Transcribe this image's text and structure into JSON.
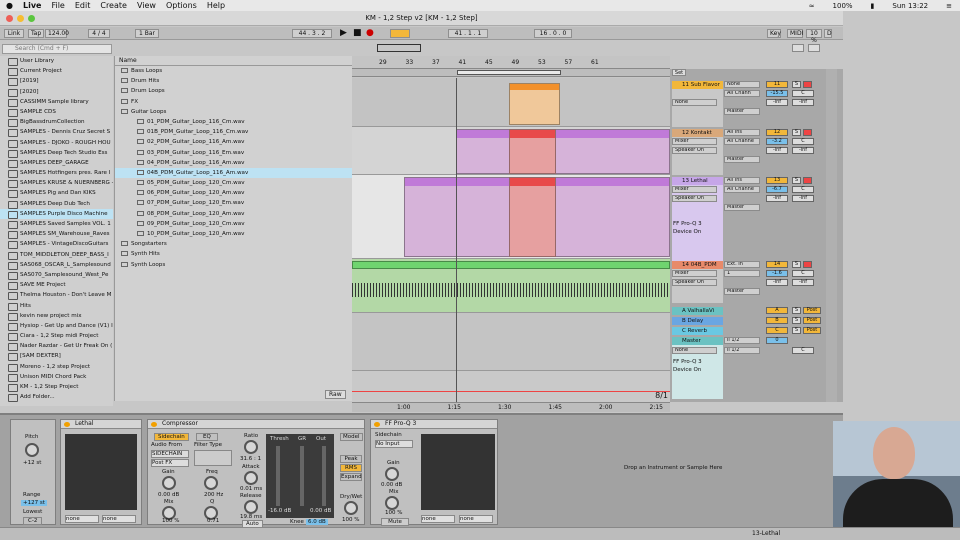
{
  "menubar": {
    "app": "Live",
    "items": [
      "File",
      "Edit",
      "Create",
      "View",
      "Options",
      "Help"
    ],
    "battery": "100%",
    "clock": "Sun 13:22"
  },
  "window": {
    "title": "KM - 1,2 Step v2  [KM - 1,2 Step]"
  },
  "transport": {
    "link": "Link",
    "tap": "Tap",
    "tempo": "124.00",
    "sig": "4 / 4",
    "quant": "1 Bar",
    "pos1": "44 .  3 .  2",
    "pos2": "41 .  1 .  1",
    "len": "16 .  0 .  0",
    "key": "Key",
    "midi": "MIDI",
    "cpu": "10 %",
    "d": "D"
  },
  "search": {
    "placeholder": "Search (Cmd + F)"
  },
  "places": [
    "User Library",
    "Current Project",
    "[2019]",
    "[2020]",
    "CASSIMM Sample library",
    "SAMPLE CDS",
    "BigBassdrumCollection",
    "SAMPLES - Dennis Cruz Secret S",
    "SAMPLES - DJOKO - ROUGH HOU",
    "SAMPLES Deep Tech Studio Ess",
    "SAMPLES DEEP_GARAGE",
    "SAMPLES Hotfingers pres. Rare I",
    "SAMPLES KRUSE & NUERNBERG -",
    "SAMPLES Pig and Dan KIKS",
    "SAMPLES Deep Dub Tech",
    "SAMPLES Purple Disco Machine",
    "SAMPLES Saved Samples VOL. 1",
    "SAMPLES SM_Warehouse_Raves",
    "SAMPLES - VintageDiscoGuitars",
    "TOM_MIDDLETON_DEEP_BASS_I",
    "SAS068_OSCAR_L_Samplesound",
    "SAS070_Samplesound_West_Pe",
    "SAVE ME Project",
    "Thelma Houston - Don't Leave M",
    "Hits",
    "kevin new project mix",
    "Hysiop - Get Up and Dance (V1) I",
    "Ciara - 1,2 Step midi Project",
    "Nader Razdar - Get Ur Freak On (",
    "[SAM DEXTER]",
    "Moreno - 1,2 step Project",
    "Unison MIDI Chord Pack",
    "KM - 1,2 Step Project",
    "Add Folder..."
  ],
  "places_selected": 15,
  "browser": {
    "header": "Name",
    "items": [
      "Bass Loops",
      "Drum Hits",
      "Drum Loops",
      "FX",
      "Guitar Loops",
      "01_PDM_Guitar_Loop_116_Cm.wav",
      "01B_PDM_Guitar_Loop_116_Cm.wav",
      "02_PDM_Guitar_Loop_116_Am.wav",
      "03_PDM_Guitar_Loop_116_Em.wav",
      "04_PDM_Guitar_Loop_116_Am.wav",
      "04B_PDM_Guitar_Loop_116_Am.wav",
      "05_PDM_Guitar_Loop_120_Cm.wav",
      "06_PDM_Guitar_Loop_120_Am.wav",
      "07_PDM_Guitar_Loop_120_Em.wav",
      "08_PDM_Guitar_Loop_120_Am.wav",
      "09_PDM_Guitar_Loop_120_Cm.wav",
      "10_PDM_Guitar_Loop_120_Am.wav",
      "Songstarters",
      "Synth Hits",
      "Synth Loops"
    ],
    "selected": 10,
    "raw": "Raw"
  },
  "ruler": [
    "29",
    "33",
    "37",
    "41",
    "45",
    "49",
    "53",
    "57",
    "61"
  ],
  "timeline": [
    "1:00",
    "1:15",
    "1:30",
    "1:45",
    "2:00",
    "2:15"
  ],
  "zoom": "8/1",
  "tracks": [
    {
      "name": "11 Sub Flavor",
      "color": "#f2b73a",
      "in": "None",
      "ch": "All Chann",
      "out": "Master",
      "num": "11",
      "vol": "-15.5",
      "pan": "C",
      "a": "-inf",
      "b": "-inf"
    },
    {
      "name": "12 Kontakt",
      "color": "#d9a87a",
      "in": "All Ins",
      "ch": "All Channe",
      "sub": "Mixer",
      "out": "Speaker On",
      "mast": "Master",
      "num": "12",
      "vol": "-3.2",
      "pan": "C",
      "a": "-inf",
      "b": "-inf"
    },
    {
      "name": "13 Lethal",
      "color": "#c6a6e8",
      "in": "All Ins",
      "ch": "All Channe",
      "sub": "Mixer",
      "out": "Speaker On",
      "mast": "Master",
      "num": "13",
      "vol": "-6.7",
      "pan": "C",
      "a": "-inf",
      "b": "-inf",
      "dev": "FF Pro-Q 3",
      "devstate": "Device On"
    },
    {
      "name": "14 04B_PDM",
      "color": "#e88a6a",
      "in": "Ext. In",
      "ch": "1",
      "sub": "Mixer",
      "out": "Speaker On",
      "mast": "Master",
      "num": "14",
      "vol": "-1.6",
      "pan": "C",
      "a": "-inf",
      "b": "-inf"
    }
  ],
  "returns": [
    {
      "name": "A ValhallaVi",
      "color": "#6bc2c2",
      "letter": "A"
    },
    {
      "name": "B Delay",
      "color": "#6aa6e2",
      "letter": "B"
    },
    {
      "name": "C Reverb",
      "color": "#6ac8e2",
      "letter": "C"
    }
  ],
  "master": {
    "name": "Master",
    "in": "None",
    "out": "ii 1/2",
    "out2": "ii 1/2",
    "vol": "0",
    "pan": "C",
    "dev": "FF Pro-Q 3",
    "devstate": "Device On",
    "post": "Post"
  },
  "devices": {
    "track": {
      "pitch_label": "Pitch",
      "pitch": "+12 st",
      "range_label": "Range",
      "range": "+127 st",
      "lowest_label": "Lowest",
      "lowest": "C-2"
    },
    "lethal": {
      "title": "Lethal",
      "sel1": "none",
      "sel2": "none"
    },
    "comp": {
      "title": "Compressor",
      "sidechain": "Sidechain",
      "eq": "EQ",
      "audio_from": "Audio From",
      "src": "SIDECHAIN",
      "post": "Post FX",
      "gain_label": "Gain",
      "gain": "0.00 dB",
      "mix_label": "Mix",
      "mix": "100 %",
      "filter_label": "Filter Type",
      "freq_label": "Freq",
      "freq": "200 Hz",
      "q_label": "Q",
      "q": "0.71",
      "ratio_label": "Ratio",
      "ratio": "31.6 : 1",
      "attack_label": "Attack",
      "attack": "0.01 ms",
      "release_label": "Release",
      "release": "19.8 ms",
      "auto": "Auto",
      "thresh_label": "Thresh",
      "gr_label": "GR",
      "out_label": "Out",
      "thresh": "-16.0 dB",
      "out": "0.00 dB",
      "knee_label": "Knee",
      "knee": "6.0 dB",
      "peak": "Peak",
      "rms": "RMS",
      "expand": "Expand",
      "drywet_label": "Dry/Wet",
      "drywet": "100 %",
      "model": "Model"
    },
    "proq": {
      "title": "FF Pro-Q 3",
      "sidechain_label": "Sidechain",
      "sc": "No Input",
      "gain_label": "Gain",
      "gain": "0.00 dB",
      "mix_label": "Mix",
      "mix": "100 %",
      "mute": "Mute",
      "sel1": "none",
      "sel2": "none"
    },
    "drop": "Drop an Instrument or Sample Here"
  },
  "statusbar": {
    "track": "13-Lethal"
  }
}
